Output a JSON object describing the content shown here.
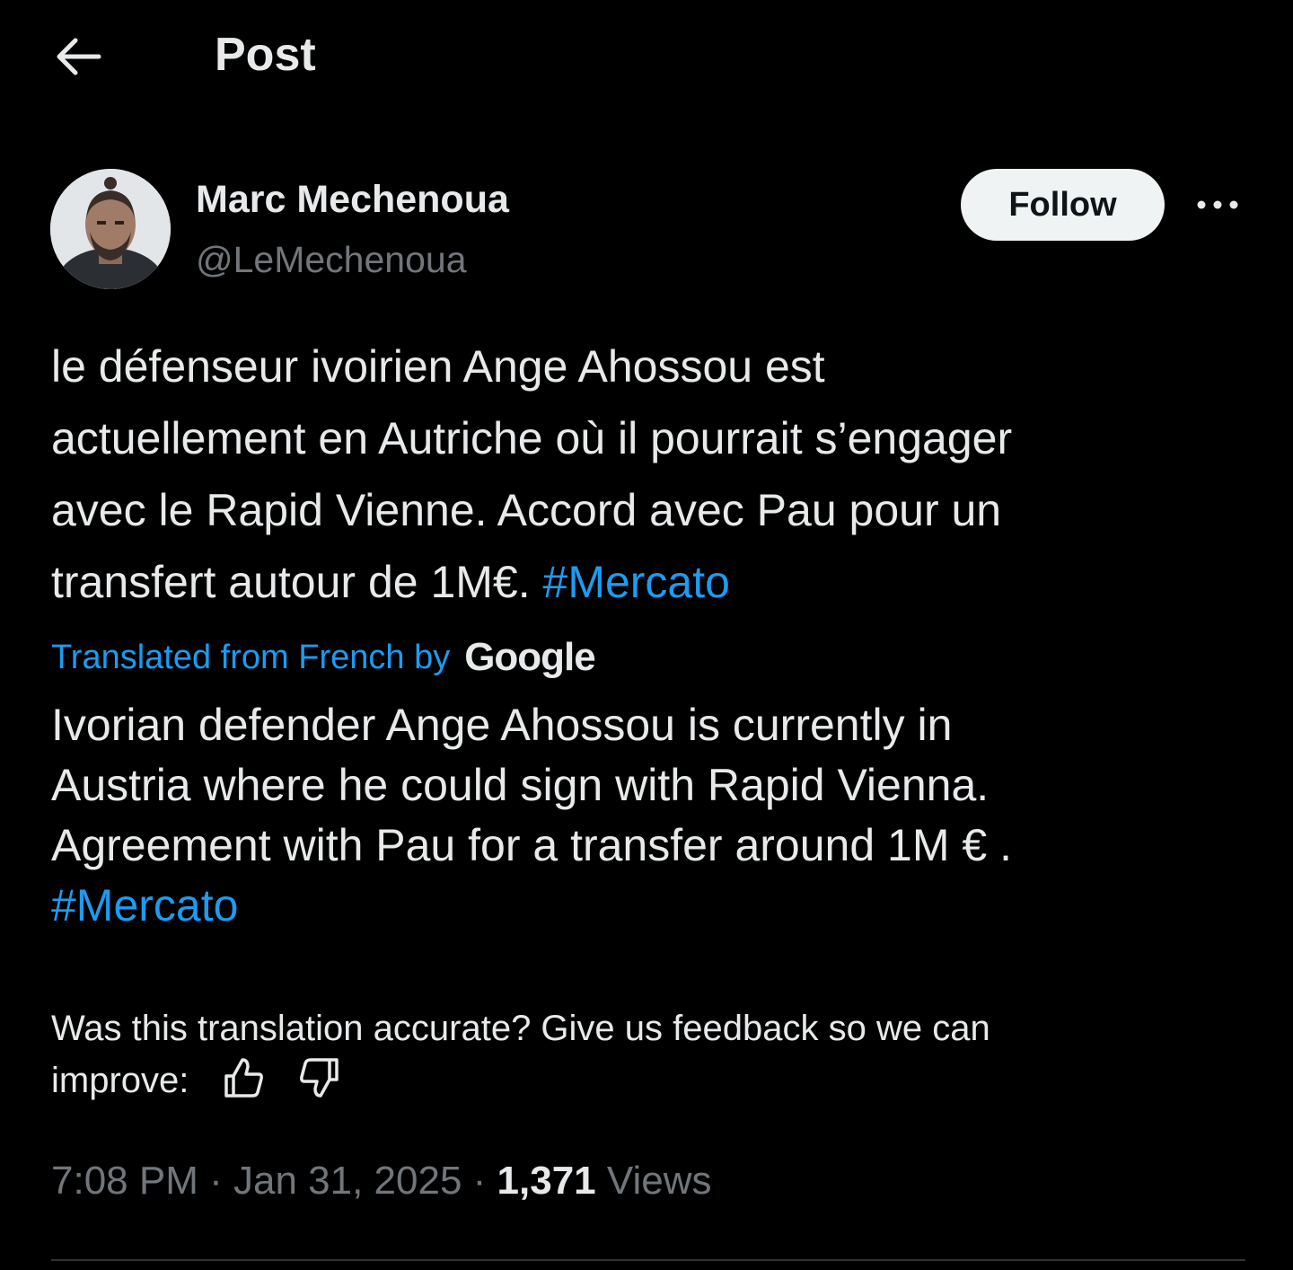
{
  "header": {
    "back_icon": "arrow-left-icon",
    "title": "Post"
  },
  "author": {
    "display_name": "Marc Mechenoua",
    "handle": "@LeMechenoua",
    "follow_label": "Follow",
    "more_icon": "more-horizontal-icon"
  },
  "tweet": {
    "lines": [
      "le défenseur ivoirien Ange Ahossou est",
      "actuellement en Autriche où il pourrait s’engager",
      "avec le Rapid Vienne. Accord avec Pau pour un"
    ],
    "last_line_text": "transfert autour de 1M€. ",
    "hashtag": "#Mercato"
  },
  "translation": {
    "label": "Translated from French by",
    "provider": "Google",
    "lines": [
      "Ivorian defender Ange Ahossou is currently in",
      "Austria where he could sign with Rapid Vienna.",
      "Agreement with Pau for a transfer around 1M € ."
    ],
    "hashtag": "#Mercato"
  },
  "feedback": {
    "line1": "Was this translation accurate? Give us feedback so we can",
    "line2": "improve:",
    "thumbs_up_icon": "thumbs-up-icon",
    "thumbs_down_icon": "thumbs-down-icon"
  },
  "meta": {
    "time": "7:08 PM",
    "separator": " · ",
    "date": "Jan 31, 2025",
    "views_count": "1,371",
    "views_label": "Views"
  },
  "colors": {
    "background": "#000000",
    "text": "#e7e9ea",
    "secondary": "#71767b",
    "accent": "#1d9bf0"
  }
}
